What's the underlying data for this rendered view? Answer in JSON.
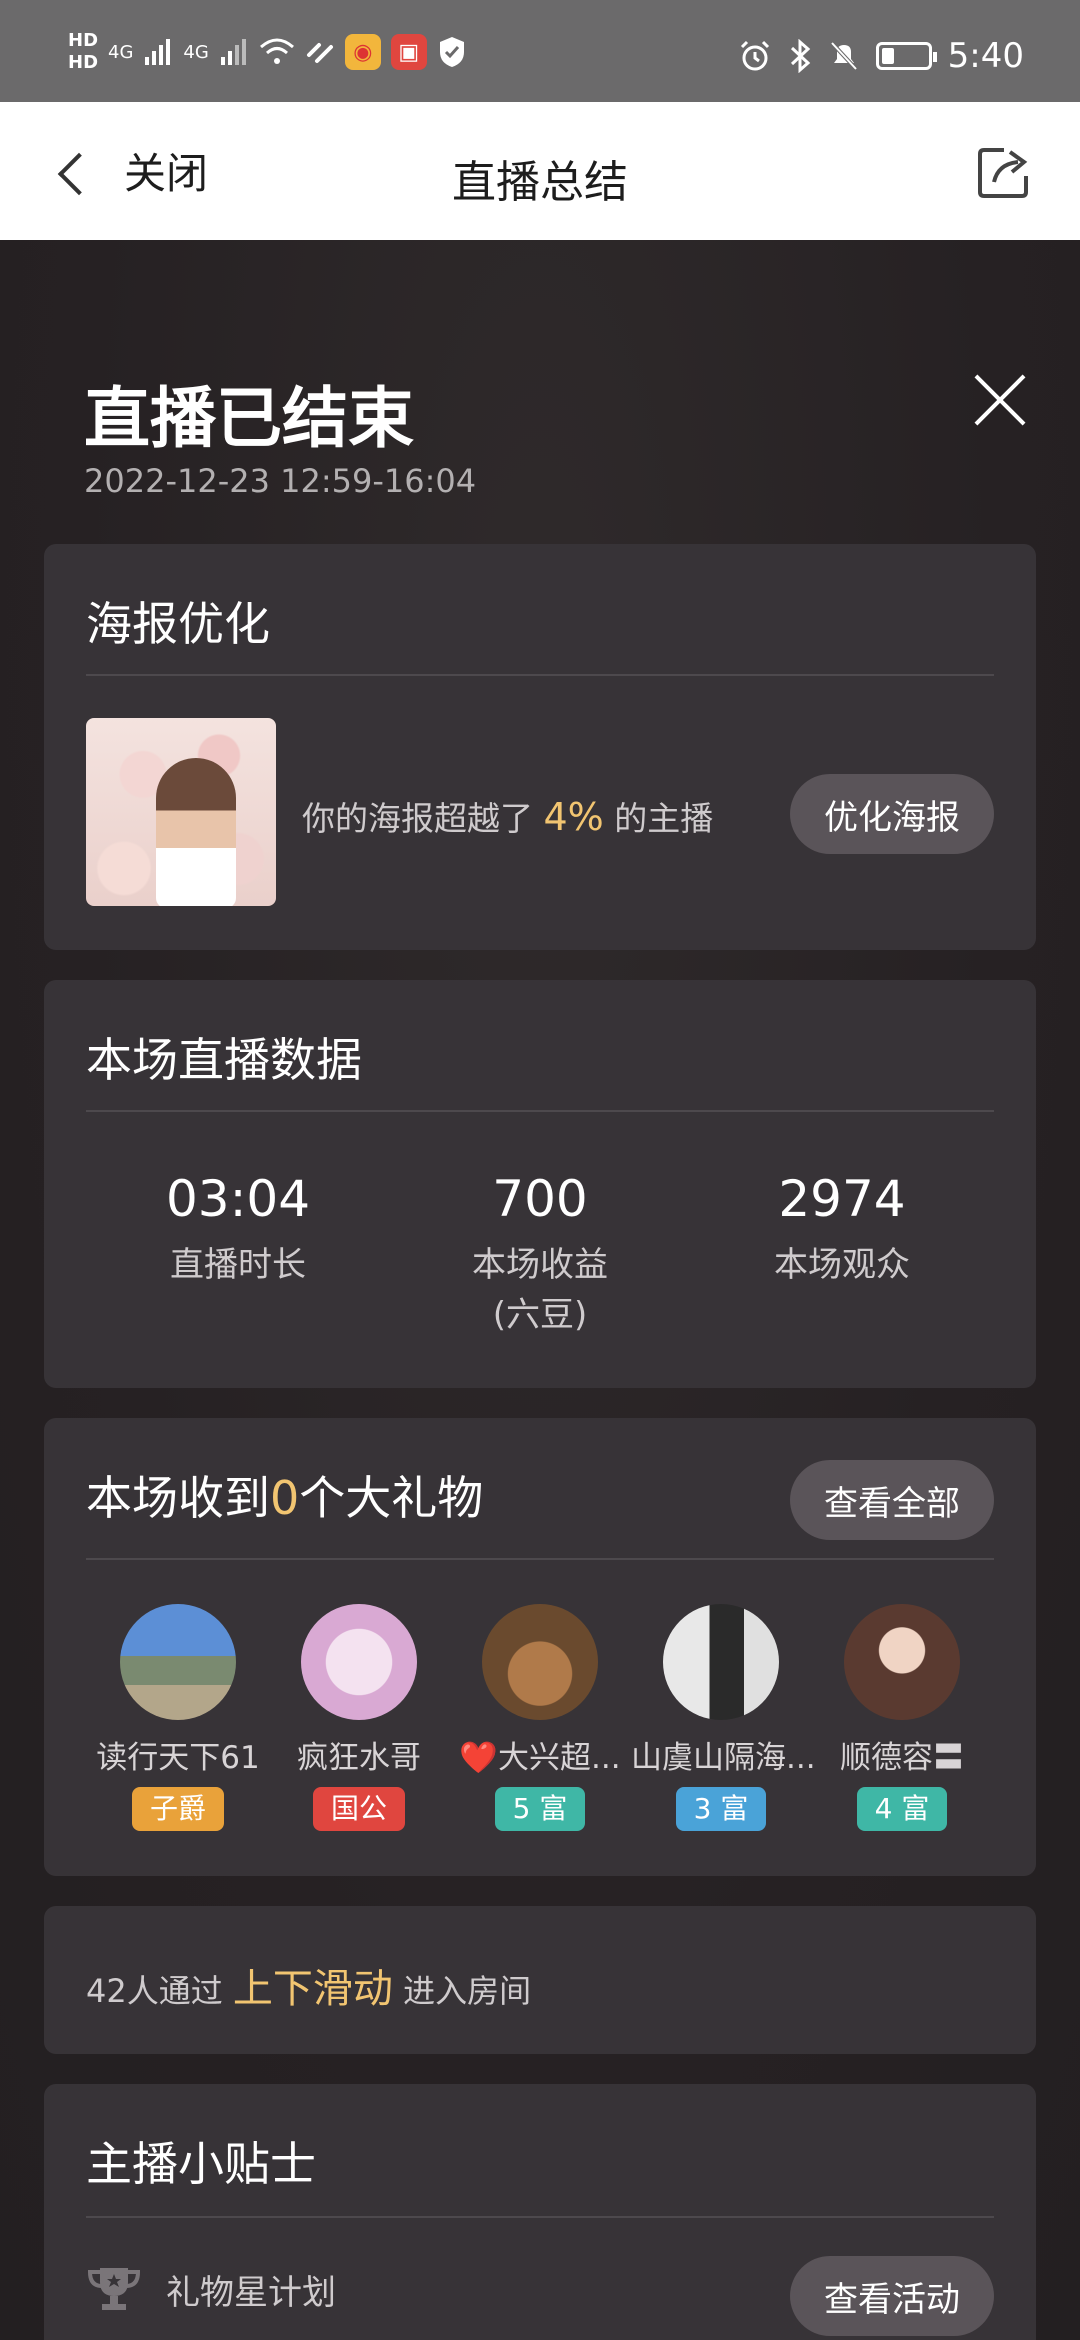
{
  "status_bar": {
    "hd1": "HD",
    "hd2": "HD",
    "signal1": "4G",
    "signal2": "4G",
    "time": "5:40"
  },
  "header": {
    "back_label": "关闭",
    "title": "直播总结"
  },
  "summary": {
    "title": "直播已结束",
    "time_range": "2022-12-23 12:59-16:04"
  },
  "poster": {
    "title": "海报优化",
    "text_prefix": "你的海报超越了",
    "percent": "4%",
    "text_suffix": "的主播",
    "button": "优化海报"
  },
  "stats": {
    "title": "本场直播数据",
    "items": [
      {
        "value": "03:04",
        "label": "直播时长",
        "sub": ""
      },
      {
        "value": "700",
        "label": "本场收益",
        "sub": "(六豆)"
      },
      {
        "value": "2974",
        "label": "本场观众",
        "sub": ""
      }
    ]
  },
  "gifts": {
    "title_prefix": "本场收到",
    "count": "0",
    "title_suffix": "个大礼物",
    "button": "查看全部",
    "users": [
      {
        "name": "读行天下61",
        "badge": "子爵",
        "badge_color": "#e9a23a"
      },
      {
        "name": "疯狂水哥",
        "badge": "国公",
        "badge_color": "#e0463f"
      },
      {
        "name": "❤️大兴超...",
        "badge": "5 富",
        "badge_color": "#3fb7a6"
      },
      {
        "name": "山虞山隔海...",
        "badge": "3 富",
        "badge_color": "#4aa3d8"
      },
      {
        "name": "顺德容〓",
        "badge": "4 富",
        "badge_color": "#3fb7a6"
      }
    ]
  },
  "slide": {
    "prefix": "42人通过",
    "highlight": "上下滑动",
    "suffix": "进入房间"
  },
  "tips": {
    "title": "主播小贴士",
    "item_label": "礼物星计划",
    "button": "查看活动"
  },
  "colors": {
    "accent": "#f2c571",
    "card_bg": "#373337",
    "page_bg": "#262123"
  }
}
